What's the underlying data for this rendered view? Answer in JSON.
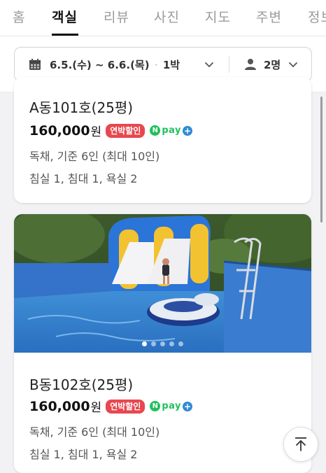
{
  "tabs": [
    {
      "label": "홈",
      "active": false
    },
    {
      "label": "객실",
      "active": true
    },
    {
      "label": "리뷰",
      "active": false
    },
    {
      "label": "사진",
      "active": false
    },
    {
      "label": "지도",
      "active": false
    },
    {
      "label": "주변",
      "active": false
    },
    {
      "label": "정보",
      "active": false
    }
  ],
  "filter": {
    "date_range": "6.5.(수) ~ 6.6.(목)",
    "separator": "·",
    "nights": "1박",
    "guests": "2명"
  },
  "rooms": [
    {
      "name": "A동101호(25평)",
      "price": "160,000",
      "currency": "원",
      "badge": "연박할인",
      "npay_n": "N",
      "npay_label": "pay",
      "npay_plus": "+",
      "occupancy": "독채, 기준 6인 (최대 10인)",
      "facilities": "침실 1, 침대 1, 욕실 2"
    },
    {
      "name": "B동102호(25평)",
      "price": "160,000",
      "currency": "원",
      "badge": "연박할인",
      "npay_n": "N",
      "npay_label": "pay",
      "npay_plus": "+",
      "occupancy": "독채, 기준 6인 (최대 10인)",
      "facilities": "침실 1, 침대 1, 욕실 2",
      "photo_count": 5,
      "photo_index": 1
    }
  ],
  "colors": {
    "badge": "#e8474f",
    "npay_green": "#1fc15c",
    "npay_blue": "#2f8bd6"
  },
  "icons": {
    "calendar": "calendar-icon",
    "chevron": "chevron-down-icon",
    "person": "person-icon",
    "scroll_top": "arrow-up-icon"
  }
}
